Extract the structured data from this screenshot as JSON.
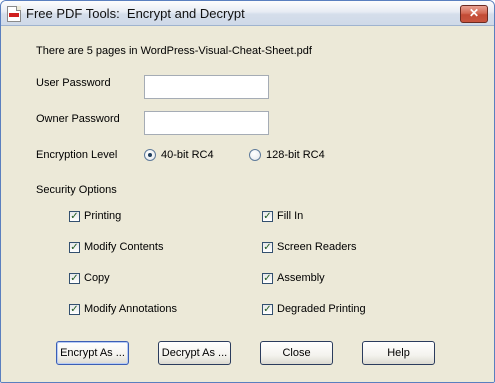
{
  "window": {
    "title": "Free PDF Tools:  Encrypt and Decrypt",
    "close_label": "✕"
  },
  "info": {
    "pages_text": "There are 5 pages in WordPress-Visual-Cheat-Sheet.pdf"
  },
  "user_password": {
    "label": "User Password",
    "value": ""
  },
  "owner_password": {
    "label": "Owner Password",
    "value": ""
  },
  "encryption": {
    "label": "Encryption Level",
    "options": [
      {
        "label": "40-bit RC4",
        "selected": true
      },
      {
        "label": "128-bit RC4",
        "selected": false
      }
    ]
  },
  "security": {
    "label": "Security Options",
    "options": [
      {
        "label": "Printing",
        "checked": true
      },
      {
        "label": "Fill In",
        "checked": true
      },
      {
        "label": "Modify Contents",
        "checked": true
      },
      {
        "label": "Screen Readers",
        "checked": true
      },
      {
        "label": "Copy",
        "checked": true
      },
      {
        "label": "Assembly",
        "checked": true
      },
      {
        "label": "Modify Annotations",
        "checked": true
      },
      {
        "label": "Degraded Printing",
        "checked": true
      }
    ]
  },
  "buttons": {
    "encrypt": "Encrypt As ...",
    "decrypt": "Decrypt As ...",
    "close": "Close",
    "help": "Help"
  }
}
